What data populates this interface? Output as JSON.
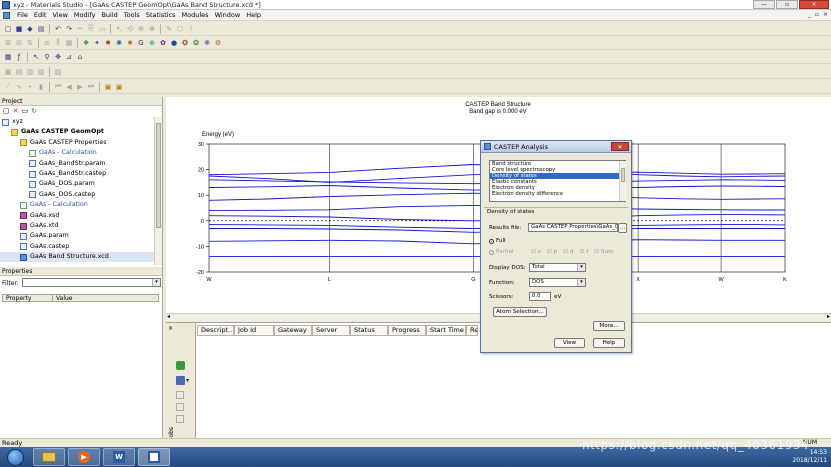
{
  "window": {
    "title": "xyz - Materials Studio - [GaAs CASTEP GeomOpt\\GaAs Band Structure.xcd *]"
  },
  "menu": [
    "File",
    "Edit",
    "View",
    "Modify",
    "Build",
    "Tools",
    "Statistics",
    "Modules",
    "Window",
    "Help"
  ],
  "project": {
    "header": "Project",
    "items": [
      {
        "label": "xyz",
        "icon": "i-doc",
        "indent": 0,
        "bold": false
      },
      {
        "label": "GaAs CASTEP GeomOpt",
        "icon": "i-fold",
        "indent": 1,
        "bold": true
      },
      {
        "label": "GaAs CASTEP Properties",
        "icon": "i-fold",
        "indent": 2,
        "bold": false
      },
      {
        "label": "GaAs - Calculation",
        "icon": "i-calc",
        "indent": 3,
        "bold": false,
        "color": "#3a4fb6"
      },
      {
        "label": "GaAs_BandStr.param",
        "icon": "i-doc",
        "indent": 3,
        "bold": false
      },
      {
        "label": "GaAs_BandStr.castep",
        "icon": "i-doc",
        "indent": 3,
        "bold": false
      },
      {
        "label": "GaAs_DOS.param",
        "icon": "i-doc",
        "indent": 3,
        "bold": false
      },
      {
        "label": "GaAs_DOS.castep",
        "icon": "i-doc",
        "indent": 3,
        "bold": false
      },
      {
        "label": "GaAs - Calculation",
        "icon": "i-calc",
        "indent": 2,
        "bold": false,
        "color": "#3a4fb6"
      },
      {
        "label": "GaAs.xsd",
        "icon": "i-xsd",
        "indent": 2,
        "bold": false
      },
      {
        "label": "GaAs.xtd",
        "icon": "i-xsd",
        "indent": 2,
        "bold": false
      },
      {
        "label": "GaAs.param",
        "icon": "i-doc",
        "indent": 2,
        "bold": false
      },
      {
        "label": "GaAs.castep",
        "icon": "i-doc",
        "indent": 2,
        "bold": false
      },
      {
        "label": "GaAs Band Structure.xcd",
        "icon": "i-grf",
        "indent": 2,
        "bold": false
      }
    ]
  },
  "properties": {
    "header": "Properties",
    "filter_label": "Filter:",
    "col_property": "Property",
    "col_value": "Value"
  },
  "chart": {
    "title": "CASTEP Band Structure",
    "subtitle": "Band gap is 0.000 eV",
    "ylabel": "Energy (eV)",
    "yticks": [
      "30",
      "20",
      "10",
      "0",
      "-10",
      "-20"
    ],
    "xticks": [
      "W",
      "L",
      "G",
      "X",
      "W",
      "K"
    ]
  },
  "chart_data": {
    "type": "line",
    "ylim": [
      -20,
      30
    ],
    "xlabels": [
      "W",
      "L",
      "G",
      "X",
      "W",
      "K"
    ],
    "xpos": [
      0,
      0.209,
      0.459,
      0.745,
      0.889,
      1.0
    ],
    "samples": [
      0,
      0.1,
      0.209,
      0.33,
      0.459,
      0.6,
      0.745,
      0.82,
      0.889,
      0.95,
      1.0
    ],
    "series": [
      {
        "values": [
          -14,
          -14,
          -14,
          -14,
          -14,
          -14,
          -14,
          -14,
          -14,
          -14,
          -14
        ]
      },
      {
        "values": [
          -8,
          -7.8,
          -7.6,
          -7.9,
          -9,
          -8.2,
          -7.4,
          -7.5,
          -7.6,
          -7.6,
          -7.6
        ]
      },
      {
        "values": [
          -3,
          -3,
          -3.2,
          -3.6,
          -4.5,
          -3.8,
          -3,
          -3,
          -3,
          -3,
          -3
        ]
      },
      {
        "values": [
          -1.5,
          -1.6,
          -1.8,
          -2.5,
          -3,
          -2.6,
          -1.8,
          -1.6,
          -1.5,
          -1.5,
          -1.6
        ]
      },
      {
        "values": [
          2,
          1.8,
          1.5,
          0.5,
          0,
          0.3,
          2,
          2.3,
          2.5,
          2.4,
          2.3
        ]
      },
      {
        "values": [
          4,
          4.1,
          4.3,
          5.5,
          6,
          5.2,
          4.6,
          4.4,
          4.3,
          4.2,
          4.2
        ]
      },
      {
        "values": [
          8,
          8.5,
          9.5,
          10.2,
          10.8,
          10,
          9,
          8.6,
          8.4,
          8.5,
          8.6
        ]
      },
      {
        "values": [
          13,
          13.3,
          13.8,
          12.8,
          12,
          12.5,
          13,
          13.4,
          13.6,
          13.5,
          13.4
        ]
      },
      {
        "values": [
          16,
          15.6,
          15.2,
          14.8,
          14.5,
          14.9,
          15.5,
          15.8,
          16,
          15.9,
          15.8
        ]
      },
      {
        "values": [
          18,
          18.4,
          18.9,
          20.5,
          22,
          20.5,
          18,
          17.5,
          17.2,
          17.4,
          17.5
        ]
      },
      {
        "values": [
          17.5,
          16.5,
          15,
          16.5,
          18,
          18.5,
          19,
          18.6,
          18.2,
          18.3,
          18.4
        ]
      }
    ]
  },
  "dialog": {
    "title": "CASTEP Analysis",
    "list": [
      "Band structure",
      "Core level spectroscopy",
      "Density of states",
      "Elastic constants",
      "Electron density",
      "Electron density difference"
    ],
    "selected_index": 2,
    "section": "Density of states",
    "results_label": "Results file:",
    "results_value": "GaAs CASTEP Properties\\GaAs_D",
    "full": "Full",
    "partial": "Partial",
    "orbitals": [
      "s",
      "p",
      "d",
      "f",
      "Sum"
    ],
    "display_label": "Display DOS:",
    "display_value": "Total",
    "function_label": "Function:",
    "function_value": "DOS",
    "scissors_label": "Scissors:",
    "scissors_value": "0.0",
    "scissors_unit": "eV",
    "atom_selection": "Atom Selection...",
    "more": "More...",
    "view": "View",
    "help": "Help"
  },
  "jobs": {
    "cols": [
      "Descript...",
      "Job Id",
      "Gateway",
      "Server",
      "Status",
      "Progress",
      "Start Time",
      "Re"
    ],
    "side_label": "Jobs"
  },
  "status": {
    "text": "Ready",
    "num": "NUM"
  },
  "taskbar": {
    "time": "14:53",
    "date": "2018/12/11"
  },
  "watermark": "https://blog.csdn.net/qq_40361934"
}
